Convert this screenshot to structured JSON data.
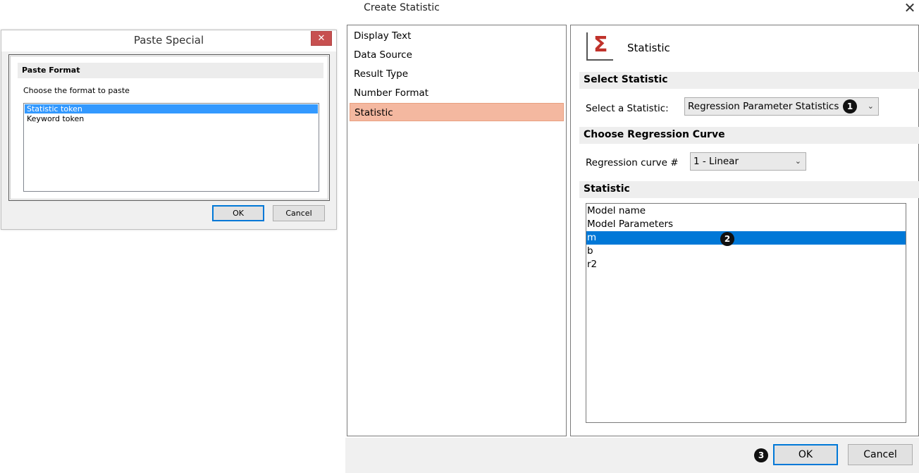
{
  "paste_special": {
    "title": "Paste Special",
    "close_glyph": "✕",
    "group_title": "Paste Format",
    "prompt": "Choose the format to paste",
    "formats": [
      "Statistic token",
      "Keyword token"
    ],
    "selected_format": "Statistic token",
    "ok_label": "OK",
    "cancel_label": "Cancel"
  },
  "create_statistic": {
    "title": "Create Statistic",
    "close_glyph": "✕",
    "nav": [
      "Display Text",
      "Data Source",
      "Result Type",
      "Number Format",
      "Statistic"
    ],
    "selected_nav": "Statistic",
    "panel": {
      "icon": "sigma-icon",
      "title": "Statistic",
      "select_statistic": {
        "section": "Select Statistic",
        "label": "Select a Statistic:",
        "value": "Regression Parameter Statistics"
      },
      "regression": {
        "section": "Choose Regression Curve",
        "label": "Regression curve #",
        "value": "1 - Linear"
      },
      "statistic_list": {
        "section": "Statistic",
        "items": [
          "Model name",
          "Model Parameters",
          "m",
          "b",
          "r2"
        ],
        "selected": "m"
      }
    },
    "ok_label": "OK",
    "cancel_label": "Cancel"
  },
  "callouts": [
    "1",
    "2",
    "3"
  ],
  "colors": {
    "nav_selected": "#f4b8a0",
    "list_selected": "#0078d7",
    "ps_selected": "#3399ff",
    "close_red": "#c75050"
  }
}
